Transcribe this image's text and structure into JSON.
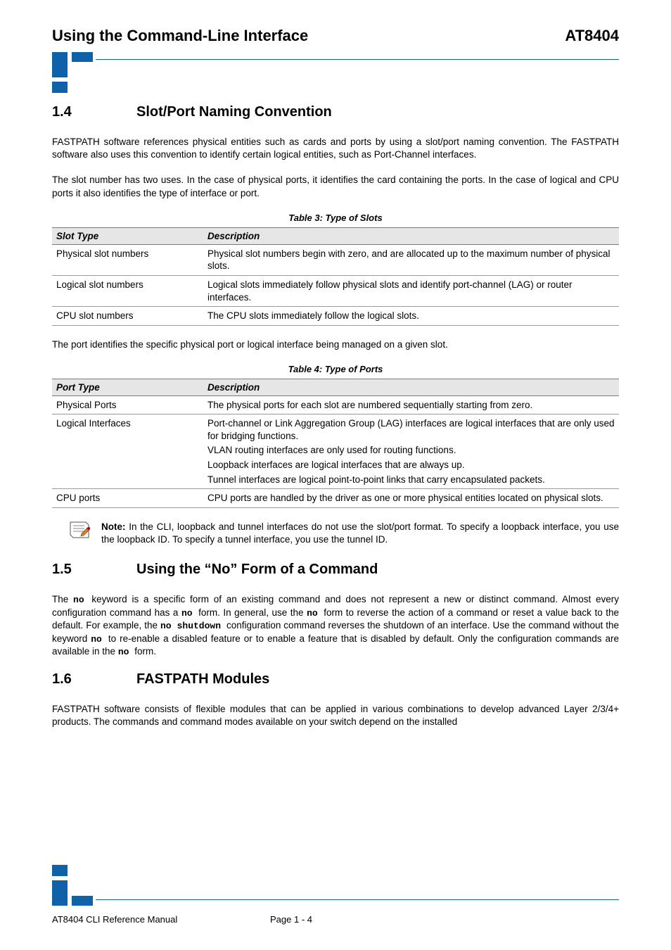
{
  "header": {
    "left": "Using the Command-Line Interface",
    "right": "AT8404"
  },
  "section14": {
    "num": "1.4",
    "title": "Slot/Port Naming Convention",
    "para1": "FASTPATH software references physical entities such as cards and ports by using a slot/port naming convention. The FASTPATH software also uses this convention to identify certain logical entities, such as Port-Channel interfaces.",
    "para2": "The slot number has two uses. In the case of physical ports, it identifies the card containing the ports. In the case of logical and CPU ports it also identifies the type of interface or port."
  },
  "table3": {
    "caption": "Table 3:  Type of Slots",
    "head_col1": "Slot Type",
    "head_col2": "Description",
    "rows": [
      {
        "type": "Physical slot numbers",
        "desc": "Physical slot numbers begin with zero, and are allocated up to the maximum number of physical slots."
      },
      {
        "type": "Logical slot numbers",
        "desc": "Logical slots immediately follow physical slots and identify port-channel (LAG) or router interfaces."
      },
      {
        "type": "CPU slot numbers",
        "desc": "The CPU slots immediately follow the logical slots."
      }
    ]
  },
  "mid_para": "The port identifies the specific physical port or logical interface being managed on a given slot.",
  "table4": {
    "caption": "Table 4:  Type of Ports",
    "head_col1": "Port Type",
    "head_col2": "Description",
    "rows": [
      {
        "type": "Physical Ports",
        "desc": [
          "The physical ports for each slot are numbered sequentially starting from zero."
        ]
      },
      {
        "type": "Logical Interfaces",
        "desc": [
          "Port-channel or Link Aggregation Group (LAG) interfaces are logical interfaces that are only used for bridging functions.",
          "VLAN routing interfaces are only used for routing functions.",
          "Loopback interfaces are logical interfaces that are always up.",
          "Tunnel interfaces are logical point-to-point links that carry encapsulated packets."
        ]
      },
      {
        "type": "CPU ports",
        "desc": [
          "CPU ports are handled by the driver as one or more physical entities located on physical slots."
        ]
      }
    ]
  },
  "note": {
    "label": "Note:",
    "text": " In the CLI, loopback and tunnel interfaces do not use the slot/port format. To specify a loopback interface, you use the loopback ID. To specify a tunnel interface, you use the tunnel ID."
  },
  "section15": {
    "num": "1.5",
    "title": "Using the “No” Form of a Command",
    "pre1": "The ",
    "kw_no1": " no ",
    "mid1": "keyword is a specific form of an existing command and does not represent a new or distinct command. Almost every configuration command has a ",
    "kw_no2": "no ",
    "mid2": "form. In general, use the ",
    "kw_no3": "no ",
    "mid3": "form to reverse the action of a command or reset a value back to the default. For example, the ",
    "kw_noshutdown": "no shutdown ",
    "mid4": " configuration command reverses the shutdown of an interface. Use the command without the keyword ",
    "kw_no4": " no ",
    "mid5": "to re-enable a disabled feature or to enable a feature that is disabled by default. Only the configuration commands are available in the ",
    "kw_no5": "no ",
    "mid6": "form."
  },
  "section16": {
    "num": "1.6",
    "title": "FASTPATH Modules",
    "para": "FASTPATH software consists of flexible modules that can be applied in various combinations to develop advanced Layer 2/3/4+ products. The commands and command modes available on your switch depend on the installed"
  },
  "footer": {
    "left": "AT8404 CLI Reference Manual",
    "center": "Page 1 - 4"
  }
}
